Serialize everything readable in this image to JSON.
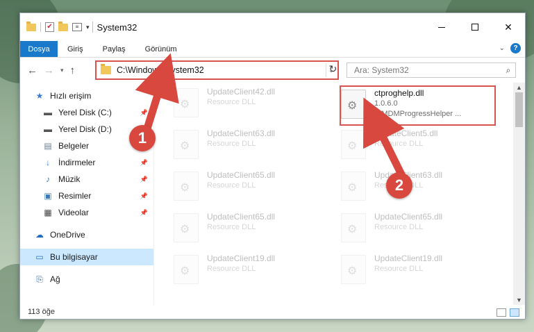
{
  "window": {
    "title": "System32"
  },
  "ribbon": {
    "tabs": [
      "Dosya",
      "Giriş",
      "Paylaş",
      "Görünüm"
    ]
  },
  "address": {
    "path": "C:\\Windows\\System32"
  },
  "search": {
    "placeholder": "Ara: System32"
  },
  "sidebar": {
    "items": [
      {
        "label": "Hızlı erişim",
        "icon": "star-icon"
      },
      {
        "label": "Yerel Disk (C:)",
        "icon": "drive-icon"
      },
      {
        "label": "Yerel Disk (D:)",
        "icon": "drive-icon"
      },
      {
        "label": "Belgeler",
        "icon": "document-icon"
      },
      {
        "label": "İndirmeler",
        "icon": "download-icon"
      },
      {
        "label": "Müzik",
        "icon": "music-icon"
      },
      {
        "label": "Resimler",
        "icon": "pictures-icon"
      },
      {
        "label": "Videolar",
        "icon": "video-icon"
      },
      {
        "label": "OneDrive",
        "icon": "cloud-icon"
      },
      {
        "label": "Bu bilgisayar",
        "icon": "computer-icon"
      },
      {
        "label": "Ağ",
        "icon": "network-icon"
      }
    ]
  },
  "highlighted_file": {
    "name": "ctproghelp.dll",
    "version": "1.0.6.0",
    "description": "WMDMProgressHelper ..."
  },
  "files": [
    {
      "name": "UpdateClient42.dll",
      "type": "Resource DLL"
    },
    {
      "name": "UpdateClient63.dll",
      "type": "Resource DLL"
    },
    {
      "name": "UpdateClient5.dll",
      "type": "Resource DLL"
    },
    {
      "name": "UpdateClient65.dll",
      "type": "Resource DLL"
    },
    {
      "name": "UpdateClient63.dll",
      "type": "Resource DLL"
    },
    {
      "name": "UpdateClient65.dll",
      "type": "Resource DLL"
    },
    {
      "name": "UpdateClient65.dll",
      "type": "Resource DLL"
    },
    {
      "name": "UpdateClient19.dll",
      "type": "Resource DLL"
    },
    {
      "name": "UpdateClient19.dll",
      "type": "Resource DLL"
    }
  ],
  "status": {
    "count": "113 öğe"
  },
  "callouts": [
    "1",
    "2"
  ],
  "colors": {
    "accent": "#1979ca",
    "callout": "#d9483f",
    "selection": "#cce8ff"
  }
}
